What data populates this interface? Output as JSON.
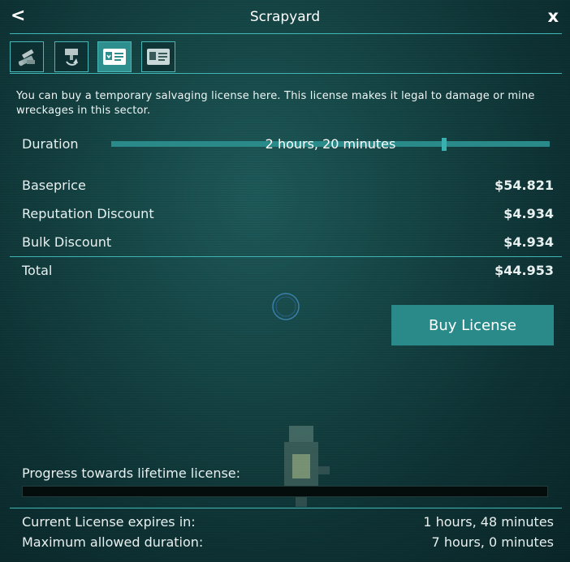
{
  "window": {
    "title": "Scrapyard",
    "back_symbol": "<",
    "close_symbol": "x"
  },
  "tabs": [
    {
      "icon": "scrap-pile-icon",
      "active": false
    },
    {
      "icon": "recycling-turret-icon",
      "active": false
    },
    {
      "icon": "license-download-icon",
      "active": true
    },
    {
      "icon": "license-card-icon",
      "active": false
    }
  ],
  "description": "You can buy a temporary salvaging license here. This license makes it legal to damage or mine wreckages in this sector.",
  "duration": {
    "label": "Duration",
    "value": "2 hours, 20 minutes",
    "fraction": 0.76
  },
  "pricing": {
    "baseprice_label": "Baseprice",
    "baseprice": "$54.821",
    "reputation_label": "Reputation Discount",
    "reputation": "$4.934",
    "bulk_label": "Bulk Discount",
    "bulk": "$4.934",
    "total_label": "Total",
    "total": "$44.953"
  },
  "buy_button": "Buy License",
  "progress": {
    "label": "Progress towards lifetime license:",
    "fraction": 0.0
  },
  "info": {
    "expires_label": "Current License expires in:",
    "expires_value": "1 hours, 48 minutes",
    "max_label": "Maximum allowed duration:",
    "max_value": "7 hours, 0 minutes"
  },
  "colors": {
    "accent": "#2a8a8a",
    "line": "#3fb5b5",
    "active_tab": "#2f8f8f"
  }
}
